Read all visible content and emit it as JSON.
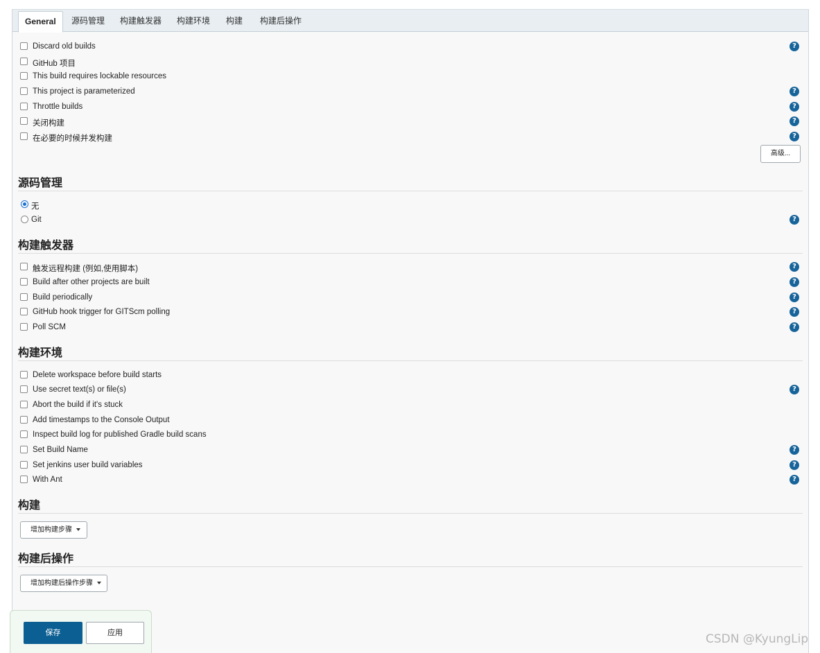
{
  "tabs": [
    {
      "label": "General"
    },
    {
      "label": "源码管理"
    },
    {
      "label": "构建触发器"
    },
    {
      "label": "构建环境"
    },
    {
      "label": "构建"
    },
    {
      "label": "构建后操作"
    }
  ],
  "general": {
    "options": [
      {
        "label": "Discard old builds",
        "help": true
      },
      {
        "label": "GitHub 项目",
        "help": false
      },
      {
        "label": "This build requires lockable resources",
        "help": false
      },
      {
        "label": "This project is parameterized",
        "help": true
      },
      {
        "label": "Throttle builds",
        "help": true
      },
      {
        "label": "关闭构建",
        "help": true
      },
      {
        "label": "在必要的时候并发构建",
        "help": true
      }
    ],
    "advanced_label": "高级..."
  },
  "scm": {
    "title": "源码管理",
    "options": [
      {
        "label": "无",
        "selected": true
      },
      {
        "label": "Git",
        "selected": false
      }
    ]
  },
  "triggers": {
    "title": "构建触发器",
    "options": [
      {
        "label": "触发远程构建 (例如,使用脚本)"
      },
      {
        "label": "Build after other projects are built"
      },
      {
        "label": "Build periodically"
      },
      {
        "label": "GitHub hook trigger for GITScm polling"
      },
      {
        "label": "Poll SCM"
      }
    ]
  },
  "environment": {
    "title": "构建环境",
    "options": [
      {
        "label": "Delete workspace before build starts",
        "help": false
      },
      {
        "label": "Use secret text(s) or file(s)",
        "help": true
      },
      {
        "label": "Abort the build if it's stuck",
        "help": false
      },
      {
        "label": "Add timestamps to the Console Output",
        "help": false
      },
      {
        "label": "Inspect build log for published Gradle build scans",
        "help": false
      },
      {
        "label": "Set Build Name",
        "help": true
      },
      {
        "label": "Set jenkins user build variables",
        "help": true
      },
      {
        "label": "With Ant",
        "help": true
      }
    ]
  },
  "build": {
    "title": "构建",
    "add_step_label": "增加构建步骤"
  },
  "post_build": {
    "title": "构建后操作",
    "add_step_label": "增加构建后操作步骤"
  },
  "footer": {
    "save_label": "保存",
    "apply_label": "应用"
  },
  "help_glyph": "?",
  "watermark": "CSDN @KyungLip",
  "colors": {
    "accent": "#0c5f93",
    "help_icon": "#17649a",
    "radio_selected": "#1a6fd1"
  }
}
